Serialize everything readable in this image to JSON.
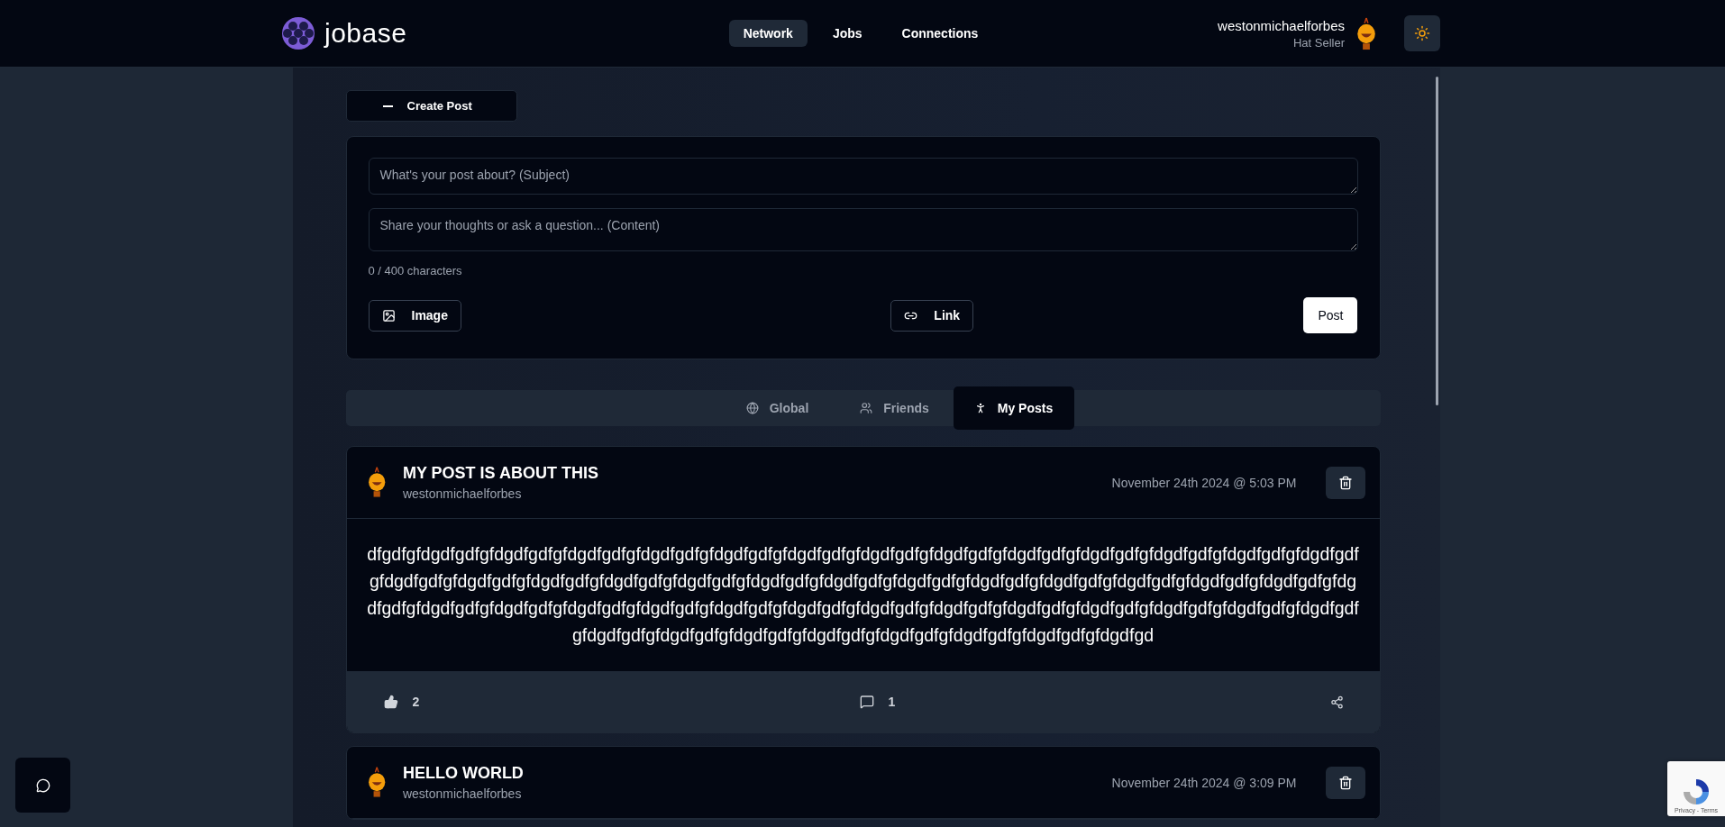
{
  "header": {
    "logo": "jobase",
    "nav": [
      {
        "label": "Network",
        "selected": true
      },
      {
        "label": "Jobs",
        "selected": false
      },
      {
        "label": "Connections",
        "selected": false
      }
    ],
    "user": {
      "name": "westonmichaelforbes",
      "title": "Hat Seller"
    }
  },
  "create_post": {
    "label": "Create Post",
    "expanded": true,
    "subject_placeholder": "What's your post about? (Subject)",
    "content_placeholder": "Share your thoughts or ask a question... (Content)",
    "counter": "0 / 400 characters",
    "image_button": "Image",
    "link_button": "Link",
    "submit_button": "Post"
  },
  "feed_tabs": [
    {
      "label": "Global",
      "kind": "globe",
      "selected": false
    },
    {
      "label": "Friends",
      "kind": "group",
      "selected": false
    },
    {
      "label": "My Posts",
      "kind": "person",
      "selected": true
    }
  ],
  "posts": [
    {
      "title": "MY POST IS ABOUT THIS",
      "author": "westonmichaelforbes",
      "date": "November 24th 2024 @ 5:03 PM",
      "body_lines": [
        "dfgdfgfdgdfgdfgfdgdfgdfgfdgdfgdfgfdgdfgdfgfdgdfgdfgfdgdfgdfgfdgdfgdfgfdgdfgdfgfdgdfgdfgfdgdfgdfgfdgdfgdfgfdgdfgdfgfdgdfgdf",
        "gfdgdfgdfgfdgdfgdfgfdgdfgdfgfdgdfgdfgfdgdfgdfgfdgdfgdfgfdgdfgdfgfdgdfgdfgfdgdfgdfgfdgdfgdfgfdgdfgdfgfdgdfgdfgfdgdfgdfgfdg",
        "dfgdfgfdgdfgdfgfdgdfgdfgfdgdfgdfgfdgdfgdfgfdgdfgdfgfdgdfgdfgfdgdfgdfgfdgdfgdfgfdgdfgdfgfdgdfgdfgfdgdfgdfgfdgdfgdfgfdgdfgdf",
        "gfdgdfgdfgfdgdfgdfgfdgdfgdfgfdgdfgdfgfdgdfgdfgfdgdfgdfgfdgdfgdfgfdgdfgd"
      ],
      "likes": "2",
      "comments": "1"
    },
    {
      "title": "HELLO WORLD",
      "author": "westonmichaelforbes",
      "date": "November 24th 2024 @ 3:09 PM"
    }
  ],
  "recaptcha": {
    "text": "Privacy - Terms"
  }
}
